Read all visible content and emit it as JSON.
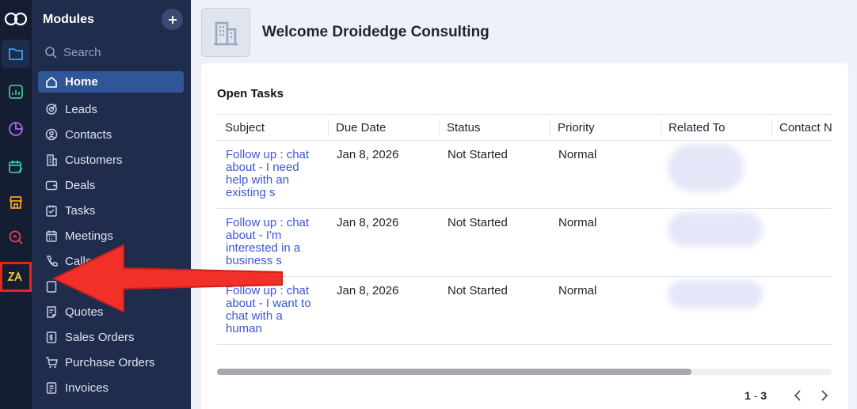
{
  "sidebar": {
    "title": "Modules",
    "search_placeholder": "Search",
    "items": [
      {
        "label": "Home",
        "icon": "home-icon",
        "active": true
      },
      {
        "label": "Leads",
        "icon": "target-icon"
      },
      {
        "label": "Contacts",
        "icon": "contact-icon"
      },
      {
        "label": "Customers",
        "icon": "building-icon"
      },
      {
        "label": "Deals",
        "icon": "wallet-icon"
      },
      {
        "label": "Tasks",
        "icon": "task-icon"
      },
      {
        "label": "Meetings",
        "icon": "calendar-icon"
      },
      {
        "label": "Calls",
        "icon": "phone-icon"
      },
      {
        "label": "",
        "icon": "document-icon"
      },
      {
        "label": "Quotes",
        "icon": "quote-icon"
      },
      {
        "label": "Sales Orders",
        "icon": "sales-order-icon"
      },
      {
        "label": "Purchase Orders",
        "icon": "cart-icon"
      },
      {
        "label": "Invoices",
        "icon": "invoice-icon"
      }
    ]
  },
  "rail": {
    "icons": [
      "crm-logo-icon",
      "folder-icon",
      "analytics-icon",
      "pie-chart-icon",
      "calendar-edit-icon",
      "store-icon",
      "search-analytics-icon",
      "zia-icon"
    ]
  },
  "header": {
    "welcome": "Welcome Droidedge Consulting"
  },
  "open_tasks": {
    "title": "Open Tasks",
    "columns": [
      "Subject",
      "Due Date",
      "Status",
      "Priority",
      "Related To",
      "Contact N"
    ],
    "rows": [
      {
        "subject": "Follow up : chat about - I need help with an existing s",
        "due": "Jan 8, 2026",
        "status": "Not Started",
        "priority": "Normal"
      },
      {
        "subject": "Follow up : chat about - I'm interested in a business s",
        "due": "Jan 8, 2026",
        "status": "Not Started",
        "priority": "Normal"
      },
      {
        "subject": "Follow up : chat about - I want to chat with a human",
        "due": "Jan 8, 2026",
        "status": "Not Started",
        "priority": "Normal"
      }
    ],
    "pager": {
      "start": "1",
      "separator": "-",
      "end": "3"
    }
  },
  "colors": {
    "rail_bg": "#151d33",
    "sidebar_bg": "#202c4c",
    "active_item": "#2f5699",
    "link": "#3c55d6",
    "annotation": "#e5261f"
  }
}
